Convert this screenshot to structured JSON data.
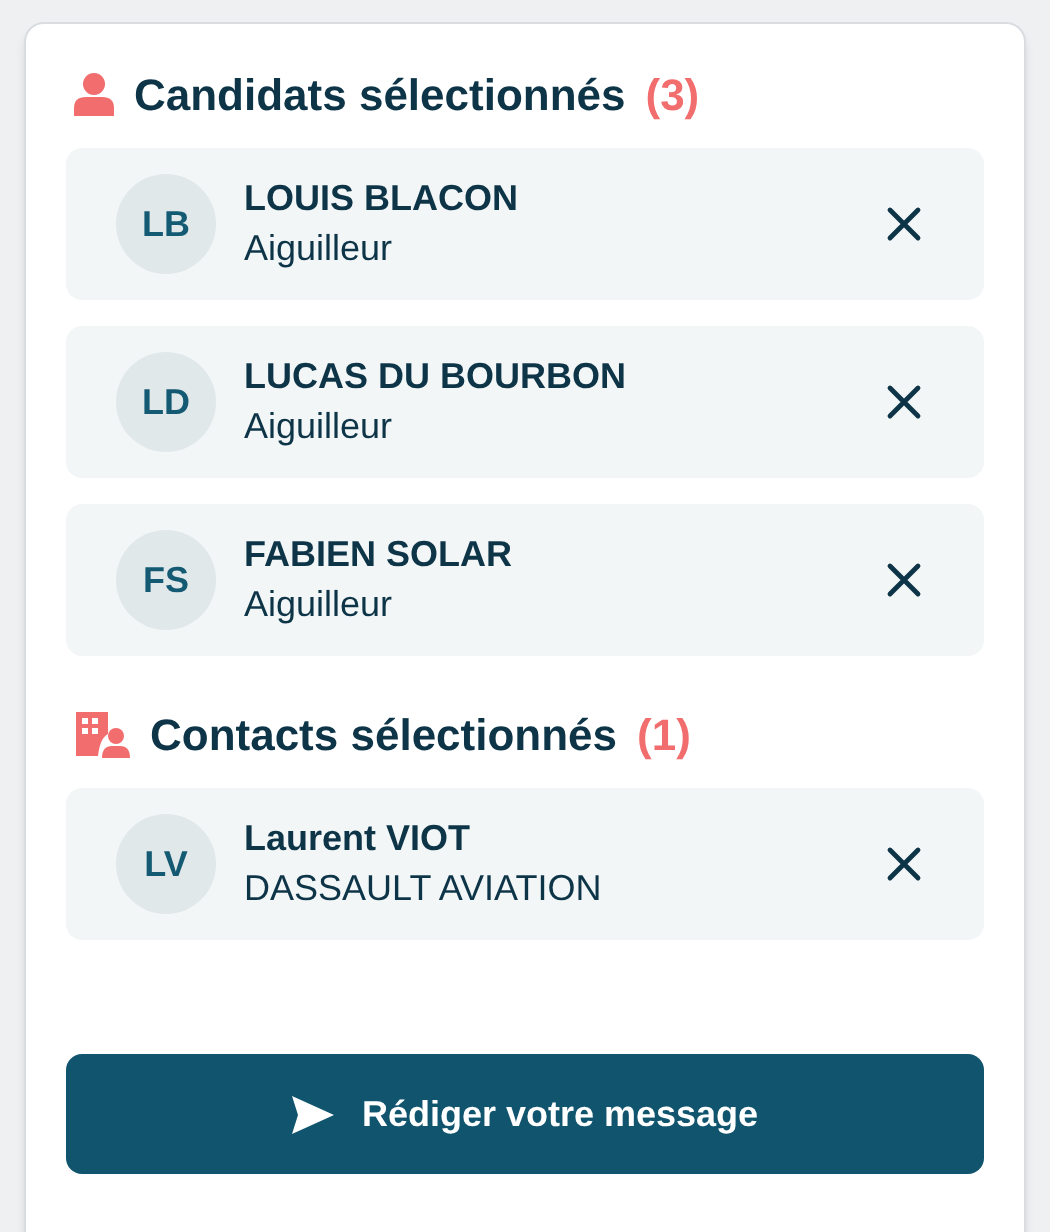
{
  "sections": [
    {
      "kind": "candidates",
      "title": "Candidats sélectionnés",
      "count": "(3)",
      "items": [
        {
          "initials": "LB",
          "name": "LOUIS BLACON",
          "subtitle": "Aiguilleur"
        },
        {
          "initials": "LD",
          "name": "LUCAS DU BOURBON",
          "subtitle": "Aiguilleur"
        },
        {
          "initials": "FS",
          "name": "FABIEN SOLAR",
          "subtitle": "Aiguilleur"
        }
      ]
    },
    {
      "kind": "contacts",
      "title": "Contacts sélectionnés",
      "count": "(1)",
      "items": [
        {
          "initials": "LV",
          "name": "Laurent VIOT",
          "subtitle": "DASSAULT AVIATION"
        }
      ]
    }
  ],
  "action": {
    "label": "Rédiger votre message"
  }
}
